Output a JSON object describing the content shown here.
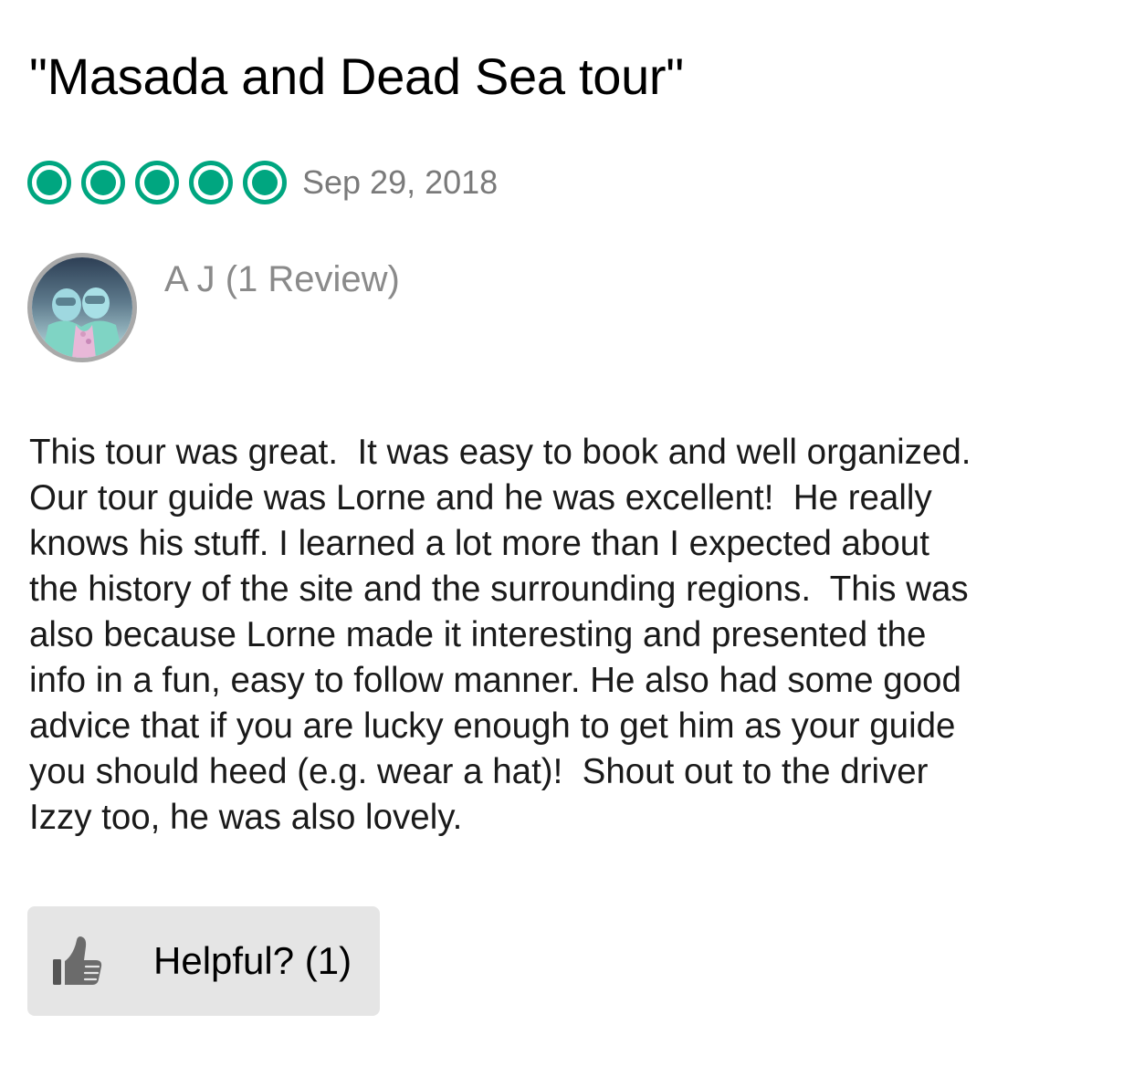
{
  "review": {
    "title": "\"Masada and Dead Sea tour\"",
    "rating": 5,
    "rating_max": 5,
    "rating_color": "#00a680",
    "date": "Sep 29, 2018",
    "reviewer": {
      "name_line": "A J (1 Review)",
      "avatar_icon": "avatar-photo"
    },
    "body_lines": [
      "This tour was great.  It was easy to book and well organized.",
      "Our tour guide was Lorne and he was excellent!  He really",
      "knows his stuff. I learned a lot more than I expected about",
      "the history of the site and the surrounding regions.  This was",
      "also because Lorne made it interesting and presented the",
      "info in a fun, easy to follow manner. He also had some good",
      "advice that if you are lucky enough to get him as your guide",
      "you should heed (e.g. wear a hat)!  Shout out to the driver",
      "Izzy too, he was also lovely."
    ]
  },
  "helpful_button": {
    "label": "Helpful? (1)",
    "icon": "thumbs-up-icon"
  }
}
